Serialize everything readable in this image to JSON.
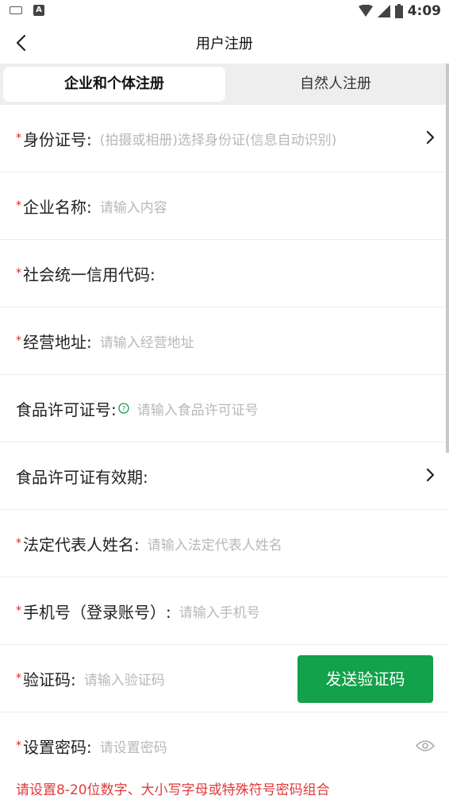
{
  "status_bar": {
    "time": "4:09",
    "icons": [
      "keyboard-icon",
      "a-icon",
      "wifi-icon",
      "signal-icon",
      "battery-icon"
    ]
  },
  "nav": {
    "title": "用户注册",
    "back_icon": "chevron-left-icon"
  },
  "tabs": [
    {
      "label": "企业和个体注册",
      "active": true
    },
    {
      "label": "自然人注册",
      "active": false
    }
  ],
  "fields": {
    "id_card": {
      "required_mark": "*",
      "label": "身份证号:",
      "placeholder": "(拍摄或相册)选择身份证(信息自动识别)"
    },
    "company_name": {
      "required_mark": "*",
      "label": "企业名称:",
      "placeholder": "请输入内容"
    },
    "credit_code": {
      "required_mark": "*",
      "label": "社会统一信用代码:",
      "placeholder": ""
    },
    "business_address": {
      "required_mark": "*",
      "label": "经营地址:",
      "placeholder": "请输入经营地址"
    },
    "food_license": {
      "label": "食品许可证号:",
      "placeholder": "请输入食品许可证号"
    },
    "license_validity": {
      "label": "食品许可证有效期:"
    },
    "legal_rep": {
      "required_mark": "*",
      "label": "法定代表人姓名:",
      "placeholder": "请输入法定代表人姓名"
    },
    "phone": {
      "required_mark": "*",
      "label": "手机号（登录账号）:",
      "placeholder": "请输入手机号"
    },
    "verify_code": {
      "required_mark": "*",
      "label": "验证码:",
      "placeholder": "请输入验证码",
      "button": "发送验证码"
    },
    "password": {
      "required_mark": "*",
      "label": "设置密码:",
      "placeholder": "请设置密码"
    }
  },
  "hint": "请设置8-20位数字、大小写字母或特殊符号密码组合",
  "colors": {
    "accent_green": "#13a14a",
    "required_red": "#e02020",
    "hint_red": "#e03a3a"
  }
}
